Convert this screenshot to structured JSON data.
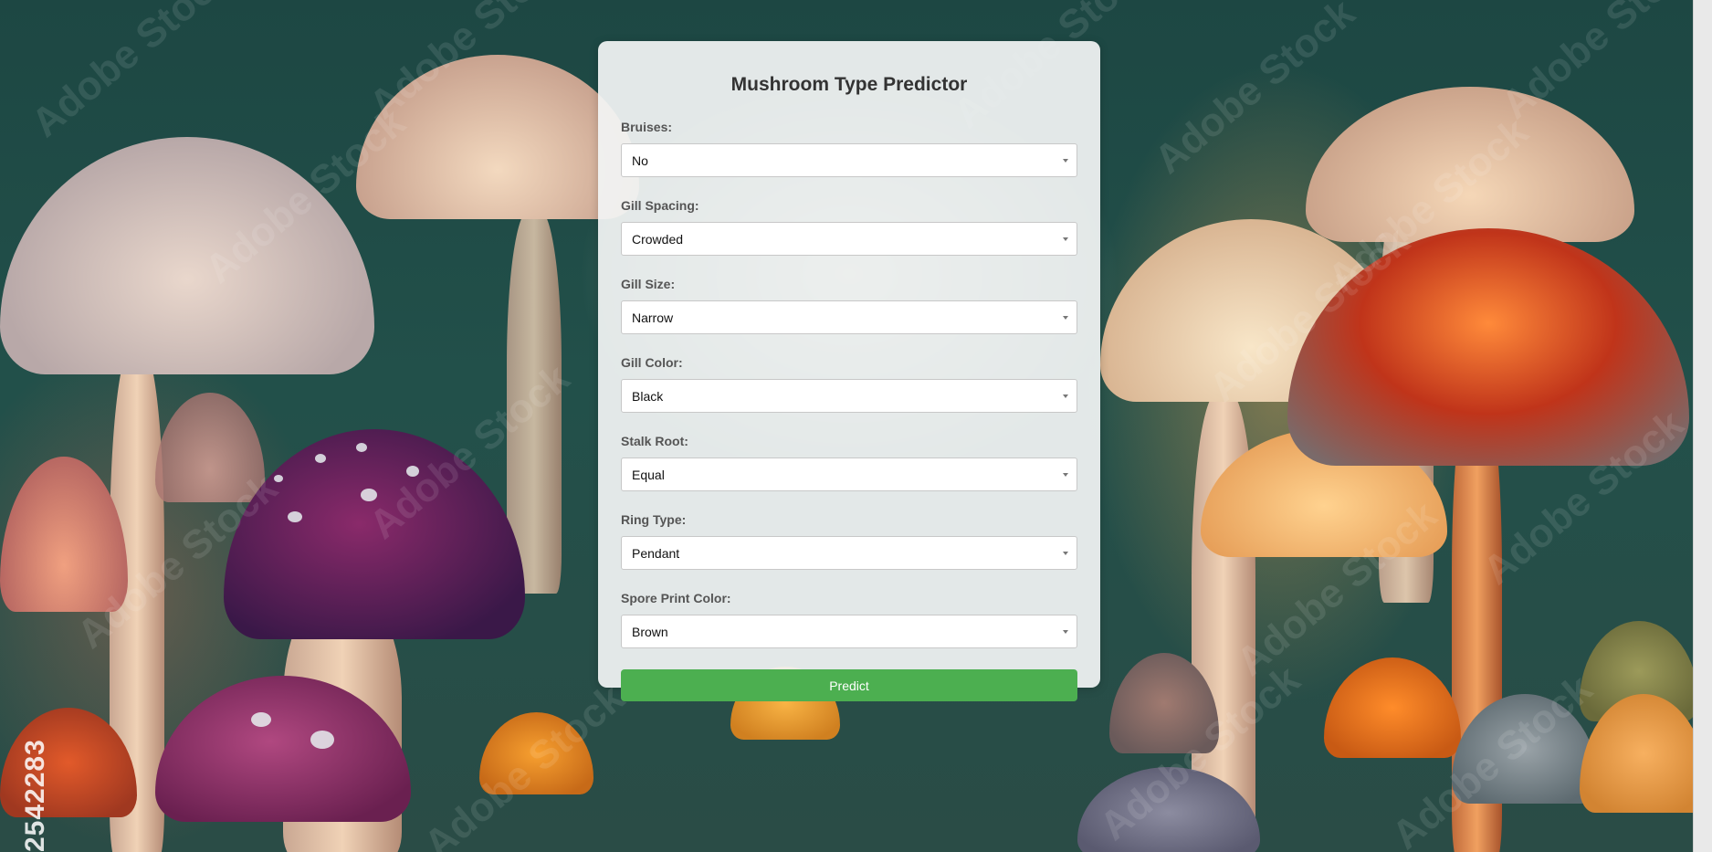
{
  "page": {
    "title": "Mushroom Type Predictor",
    "background_id": "2542283"
  },
  "form": {
    "fields": [
      {
        "label": "Bruises:",
        "value": "No"
      },
      {
        "label": "Gill Spacing:",
        "value": "Crowded"
      },
      {
        "label": "Gill Size:",
        "value": "Narrow"
      },
      {
        "label": "Gill Color:",
        "value": "Black"
      },
      {
        "label": "Stalk Root:",
        "value": "Equal"
      },
      {
        "label": "Ring Type:",
        "value": "Pendant"
      },
      {
        "label": "Spore Print Color:",
        "value": "Brown"
      }
    ],
    "submit_label": "Predict"
  },
  "colors": {
    "button_bg": "#4caf50",
    "card_bg": "#f2f4f4",
    "background_teal": "#1e4a45"
  },
  "watermark_text": "Adobe Stock"
}
